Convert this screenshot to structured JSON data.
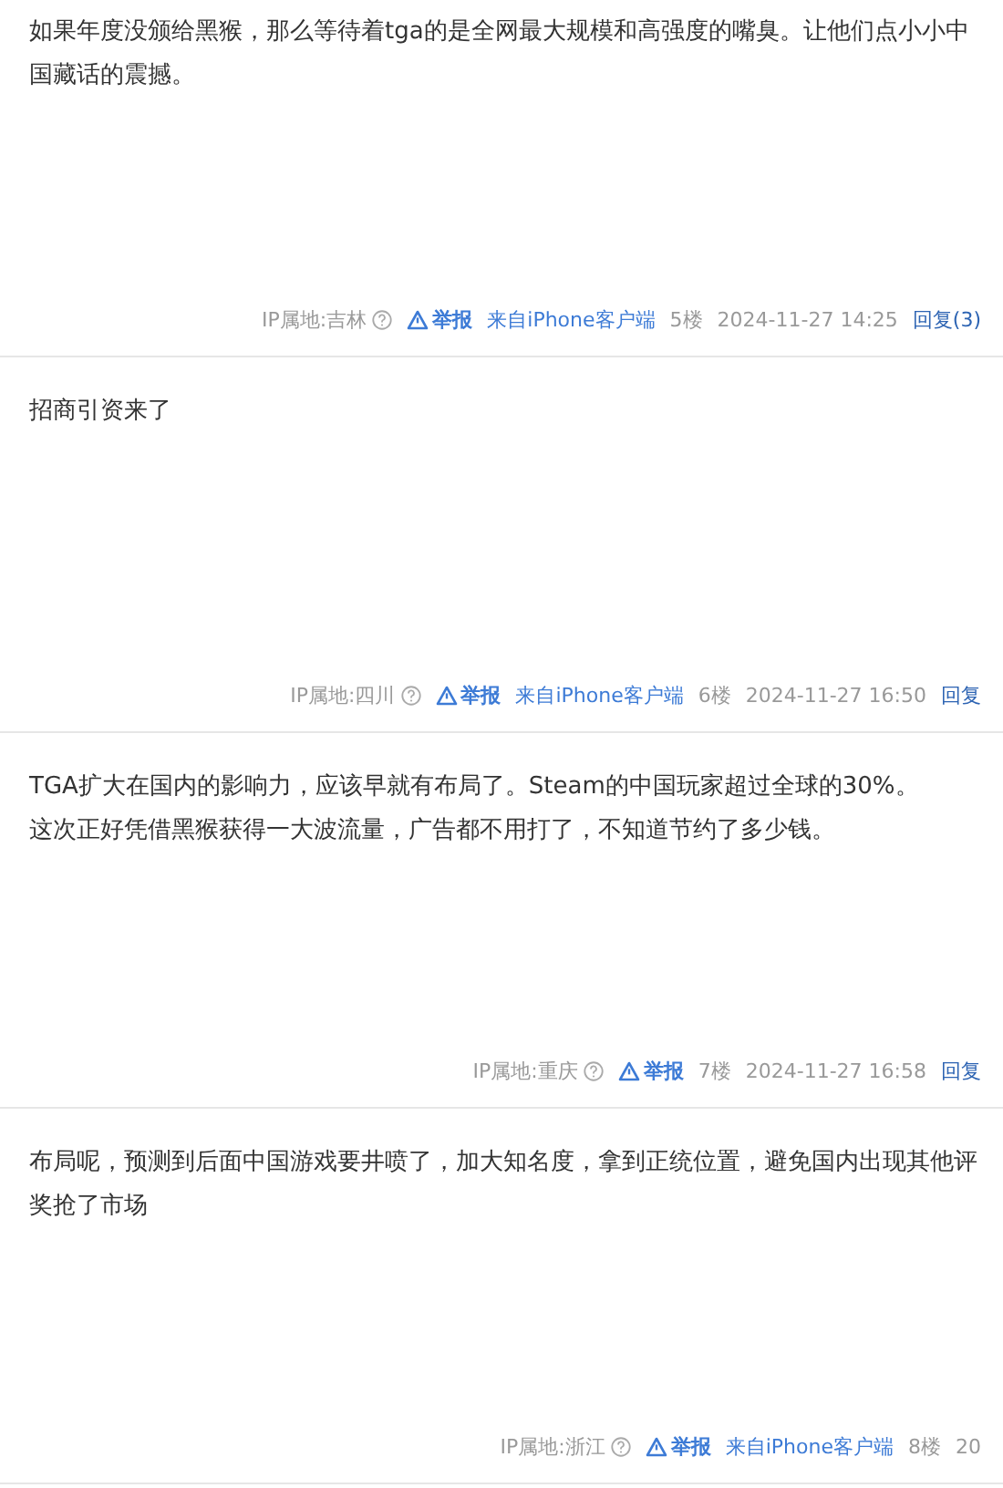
{
  "posts": [
    {
      "paragraphs": [
        "如果年度没颁给黑猴，那么等待着tga的是全网最大规模和高强度的嘴臭。让他们点小小中国藏话的震撼。"
      ],
      "ip": "IP属地:吉林",
      "report": "举报",
      "source": "来自iPhone客户端",
      "floor": "5楼",
      "time": "2024-11-27 14:25",
      "reply": "回复(3)"
    },
    {
      "paragraphs": [
        "招商引资来了"
      ],
      "ip": "IP属地:四川",
      "report": "举报",
      "source": "来自iPhone客户端",
      "floor": "6楼",
      "time": "2024-11-27 16:50",
      "reply": "回复"
    },
    {
      "paragraphs": [
        "TGA扩大在国内的影响力，应该早就有布局了。Steam的中国玩家超过全球的30%。",
        "这次正好凭借黑猴获得一大波流量，广告都不用打了，不知道节约了多少钱。"
      ],
      "ip": "IP属地:重庆",
      "report": "举报",
      "floor": "7楼",
      "time": "2024-11-27 16:58",
      "reply": "回复"
    },
    {
      "paragraphs": [
        "布局呢，预测到后面中国游戏要井喷了，加大知名度，拿到正统位置，避免国内出现其他评奖抢了市场"
      ],
      "ip": "IP属地:浙江",
      "report": "举报",
      "source": "来自iPhone客户端",
      "floor": "8楼",
      "time": "20"
    }
  ]
}
